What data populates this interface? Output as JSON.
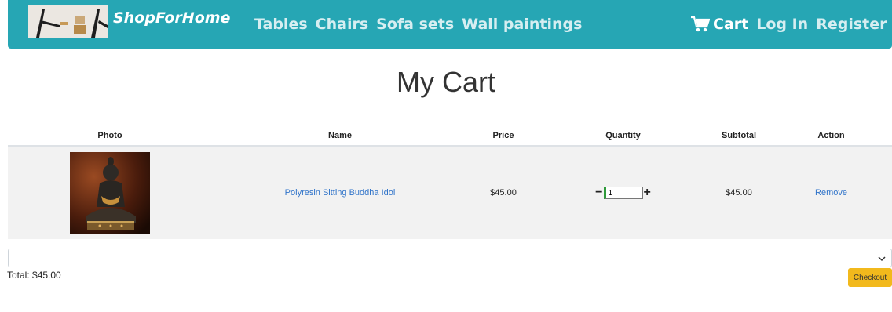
{
  "navbar": {
    "brand": "ShopForHome",
    "links": [
      "Tables",
      "Chairs",
      "Sofa sets",
      "Wall paintings"
    ],
    "cart_label": "Cart",
    "cart_icon": "shopping-cart-icon",
    "login": "Log In",
    "register": "Register",
    "bg_color": "#26a6b4"
  },
  "page": {
    "title": "My Cart"
  },
  "table": {
    "headers": [
      "Photo",
      "Name",
      "Price",
      "Quantity",
      "Subtotal",
      "Action"
    ],
    "rows": [
      {
        "name": "Polyresin Sitting Buddha Idol",
        "price": "$45.00",
        "quantity": "1",
        "subtotal": "$45.00",
        "action": "Remove"
      }
    ]
  },
  "quantity_controls": {
    "minus": "−",
    "plus": "+"
  },
  "summary": {
    "total": "Total: $45.00",
    "checkout": "Checkout"
  },
  "colors": {
    "accent": "#26a6b4",
    "checkout": "#f2b91c",
    "link": "#2f73c9"
  }
}
